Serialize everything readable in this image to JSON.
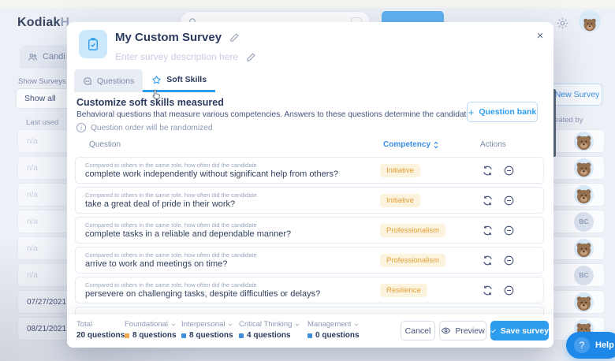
{
  "page": {
    "logo_brand": "Kodiak",
    "logo_suffix": "H",
    "nav_candidates": "Candi",
    "filters": {
      "show_surveys_label": "Show Surveys U",
      "show_all_value": "Show all"
    },
    "left_table": {
      "header": "Last used",
      "cells": [
        "n/a",
        "n/a",
        "n/a",
        "n/a",
        "n/a",
        "n/a",
        "07/27/2021",
        "08/21/2021"
      ]
    },
    "right_table": {
      "new_survey_button": "New Survey",
      "header": "eated by",
      "avatars": [
        "bear",
        "bear",
        "bear",
        "BC",
        "bear",
        "BC",
        "bear",
        "bear"
      ]
    },
    "help": {
      "q": "?",
      "label": "Help"
    }
  },
  "modal": {
    "title": "My Custom Survey",
    "description_placeholder": "Enter survey description here",
    "close_glyph": "×",
    "tabs": [
      {
        "label": "Questions",
        "active": false
      },
      {
        "label": "Soft Skills",
        "active": true
      }
    ],
    "section": {
      "heading": "Customize soft skills measured",
      "subheading": "Behavioral questions that measure various competencies. Answers to these questions determine the candidate's scores.",
      "info_note": "Question order will be randomized",
      "question_bank": {
        "plus": "+",
        "label": "Question bank"
      }
    },
    "table": {
      "headers": {
        "question": "Question",
        "competency": "Competency",
        "actions": "Actions"
      },
      "row_prefix": "Compared to others in the same role, how often did the candidate",
      "rows": [
        {
          "question": "complete work independently without significant help from others?",
          "competency": "Initiative"
        },
        {
          "question": "take a great deal of pride in their work?",
          "competency": "Initiative"
        },
        {
          "question": "complete tasks in a reliable and dependable manner?",
          "competency": "Professionalism"
        },
        {
          "question": "arrive to work and meetings on time?",
          "competency": "Professionalism"
        },
        {
          "question": "persevere on challenging tasks, despite difficulties or delays?",
          "competency": "Resilience"
        }
      ]
    },
    "footer": {
      "stats": [
        {
          "label": "Total",
          "value": "20 questions",
          "square": null
        },
        {
          "label": "Foundational",
          "value": "8 questions",
          "square": "#F0A64A"
        },
        {
          "label": "Interpersonal",
          "value": "8 questions",
          "square": "#3E8EDE"
        },
        {
          "label": "Critical Thinking",
          "value": "4 questions",
          "square": "#3E8EDE"
        },
        {
          "label": "Management",
          "value": "0 questions",
          "square": "#3E8EDE"
        }
      ],
      "cancel": "Cancel",
      "preview": "Preview",
      "save": "Save survey"
    }
  },
  "icons": {
    "search-icon": "magnifier",
    "gear-icon": "settings gear",
    "people-icon": "two people",
    "clipboard-check-icon": "clipboard with check",
    "pencil-icon": "edit pencil",
    "chat-bubble-icon": "speech bubble",
    "star-icon": "star outline",
    "info-icon": "circled i",
    "sort-icon": "sort arrows",
    "swap-icon": "circular refresh arrows",
    "remove-icon": "circled minus",
    "eye-icon": "preview eye",
    "check-icon": "checkmark",
    "chevron-down-icon": "caret down",
    "bear-avatar-icon": "bear mascot avatar",
    "cursor-pointer-icon": "hand cursor"
  },
  "colors": {
    "accent_blue": "#2F9DED",
    "competency_badge_bg": "#FCF3DE",
    "competency_badge_text": "#E09E35",
    "foundational_square": "#F0A64A",
    "skill_square_blue": "#3E8EDE",
    "help_button": "#1E88E8"
  }
}
